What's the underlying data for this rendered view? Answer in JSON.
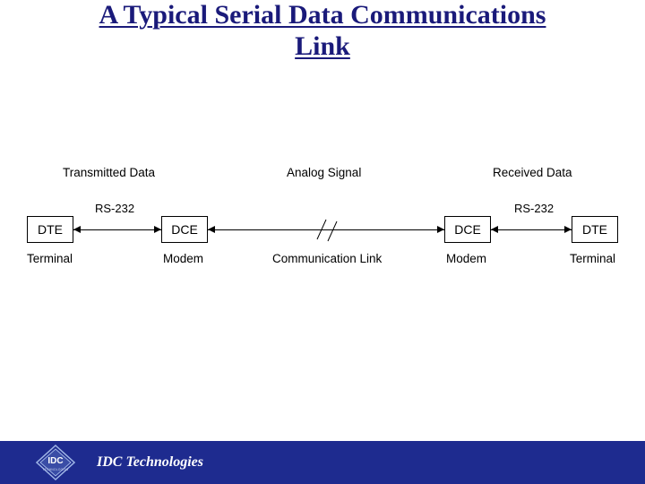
{
  "title_line1": "A Typical Serial Data Communications",
  "title_line2": "Link",
  "diagram": {
    "top_labels": {
      "transmitted": "Transmitted Data",
      "analog": "Analog Signal",
      "received": "Received Data"
    },
    "rs_left": "RS-232",
    "rs_right": "RS-232",
    "nodes": {
      "dte_left": "DTE",
      "dce_left": "DCE",
      "dce_right": "DCE",
      "dte_right": "DTE"
    },
    "bottom_labels": {
      "terminal_left": "Terminal",
      "modem_left": "Modem",
      "comm_link": "Communication Link",
      "modem_right": "Modem",
      "terminal_right": "Terminal"
    }
  },
  "footer": {
    "company": "IDC Technologies",
    "logo_text": "IDC",
    "logo_sub": "TECHNOLOGIES"
  },
  "colors": {
    "title": "#1a1a7a",
    "footer_bg": "#1e2b8f"
  }
}
